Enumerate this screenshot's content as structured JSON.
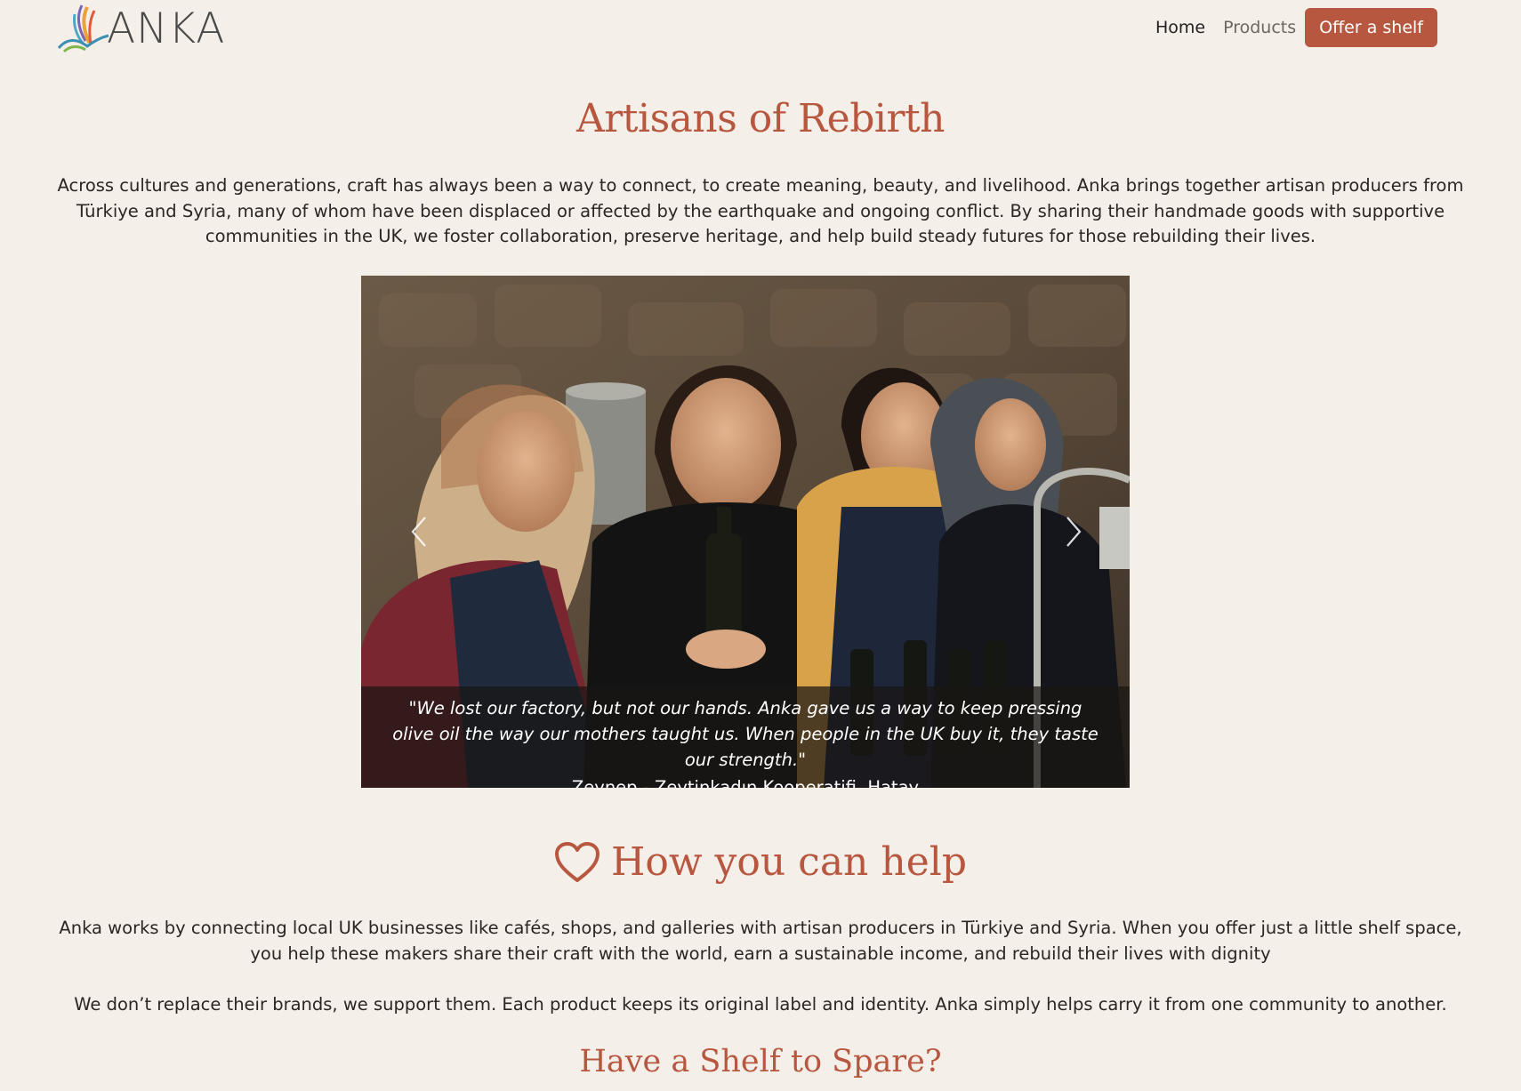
{
  "header": {
    "logo_text": "ANKA",
    "nav": {
      "home": "Home",
      "products": "Products",
      "offer_button": "Offer a shelf"
    }
  },
  "intro": {
    "title": "Artisans of Rebirth",
    "text": "Across cultures and generations, craft has always been a way to connect, to create meaning, beauty, and livelihood. Anka brings together artisan producers from Türkiye and Syria, many of whom have been displaced or affected by the earthquake and ongoing conflict. By sharing their handmade goods with supportive communities in the UK, we foster collaboration, preserve heritage, and help build steady futures for those rebuilding their lives."
  },
  "carousel": {
    "quote": "\"We lost our factory, but not our hands. Anka gave us a way to keep pressing olive oil the way our mothers taught us. When people in the UK buy it, they taste our strength.\"",
    "author": "Zeynep - Zeytinkadın Kooperatifi, Hatay",
    "prev_icon": "chevron-left-icon",
    "next_icon": "chevron-right-icon"
  },
  "help": {
    "icon": "heart-icon",
    "title": "How you can help",
    "text1": "Anka works by connecting local UK businesses like cafés, shops, and galleries with artisan producers in Türkiye and Syria. When you offer just a little shelf space, you help these makers share their craft with the world, earn a sustainable income, and rebuild their lives with dignity",
    "text2": "We don’t replace their brands, we support them. Each product keeps its original label and identity. Anka simply helps carry it from one community to another."
  },
  "shelf": {
    "title": "Have a Shelf to Spare?"
  },
  "colors": {
    "accent": "#b8573f",
    "background": "#f4efe8"
  }
}
